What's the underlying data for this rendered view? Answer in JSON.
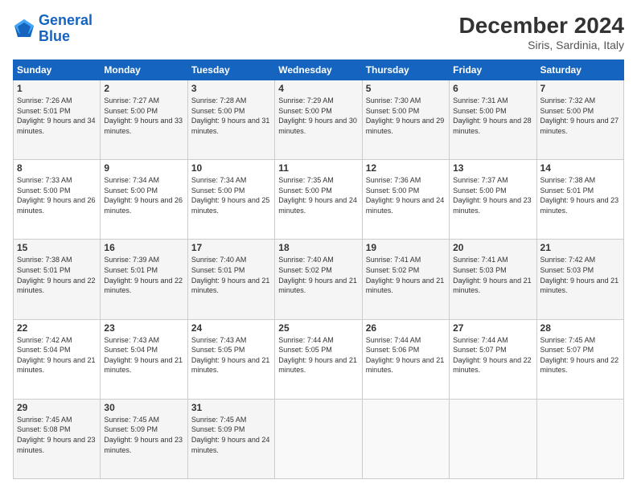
{
  "header": {
    "logo": {
      "line1": "General",
      "line2": "Blue"
    },
    "title": "December 2024",
    "subtitle": "Siris, Sardinia, Italy"
  },
  "weekdays": [
    "Sunday",
    "Monday",
    "Tuesday",
    "Wednesday",
    "Thursday",
    "Friday",
    "Saturday"
  ],
  "weeks": [
    [
      {
        "day": "1",
        "sunrise": "7:26 AM",
        "sunset": "5:01 PM",
        "daylight": "9 hours and 34 minutes."
      },
      {
        "day": "2",
        "sunrise": "7:27 AM",
        "sunset": "5:00 PM",
        "daylight": "9 hours and 33 minutes."
      },
      {
        "day": "3",
        "sunrise": "7:28 AM",
        "sunset": "5:00 PM",
        "daylight": "9 hours and 31 minutes."
      },
      {
        "day": "4",
        "sunrise": "7:29 AM",
        "sunset": "5:00 PM",
        "daylight": "9 hours and 30 minutes."
      },
      {
        "day": "5",
        "sunrise": "7:30 AM",
        "sunset": "5:00 PM",
        "daylight": "9 hours and 29 minutes."
      },
      {
        "day": "6",
        "sunrise": "7:31 AM",
        "sunset": "5:00 PM",
        "daylight": "9 hours and 28 minutes."
      },
      {
        "day": "7",
        "sunrise": "7:32 AM",
        "sunset": "5:00 PM",
        "daylight": "9 hours and 27 minutes."
      }
    ],
    [
      {
        "day": "8",
        "sunrise": "7:33 AM",
        "sunset": "5:00 PM",
        "daylight": "9 hours and 26 minutes."
      },
      {
        "day": "9",
        "sunrise": "7:34 AM",
        "sunset": "5:00 PM",
        "daylight": "9 hours and 26 minutes."
      },
      {
        "day": "10",
        "sunrise": "7:34 AM",
        "sunset": "5:00 PM",
        "daylight": "9 hours and 25 minutes."
      },
      {
        "day": "11",
        "sunrise": "7:35 AM",
        "sunset": "5:00 PM",
        "daylight": "9 hours and 24 minutes."
      },
      {
        "day": "12",
        "sunrise": "7:36 AM",
        "sunset": "5:00 PM",
        "daylight": "9 hours and 24 minutes."
      },
      {
        "day": "13",
        "sunrise": "7:37 AM",
        "sunset": "5:00 PM",
        "daylight": "9 hours and 23 minutes."
      },
      {
        "day": "14",
        "sunrise": "7:38 AM",
        "sunset": "5:01 PM",
        "daylight": "9 hours and 23 minutes."
      }
    ],
    [
      {
        "day": "15",
        "sunrise": "7:38 AM",
        "sunset": "5:01 PM",
        "daylight": "9 hours and 22 minutes."
      },
      {
        "day": "16",
        "sunrise": "7:39 AM",
        "sunset": "5:01 PM",
        "daylight": "9 hours and 22 minutes."
      },
      {
        "day": "17",
        "sunrise": "7:40 AM",
        "sunset": "5:01 PM",
        "daylight": "9 hours and 21 minutes."
      },
      {
        "day": "18",
        "sunrise": "7:40 AM",
        "sunset": "5:02 PM",
        "daylight": "9 hours and 21 minutes."
      },
      {
        "day": "19",
        "sunrise": "7:41 AM",
        "sunset": "5:02 PM",
        "daylight": "9 hours and 21 minutes."
      },
      {
        "day": "20",
        "sunrise": "7:41 AM",
        "sunset": "5:03 PM",
        "daylight": "9 hours and 21 minutes."
      },
      {
        "day": "21",
        "sunrise": "7:42 AM",
        "sunset": "5:03 PM",
        "daylight": "9 hours and 21 minutes."
      }
    ],
    [
      {
        "day": "22",
        "sunrise": "7:42 AM",
        "sunset": "5:04 PM",
        "daylight": "9 hours and 21 minutes."
      },
      {
        "day": "23",
        "sunrise": "7:43 AM",
        "sunset": "5:04 PM",
        "daylight": "9 hours and 21 minutes."
      },
      {
        "day": "24",
        "sunrise": "7:43 AM",
        "sunset": "5:05 PM",
        "daylight": "9 hours and 21 minutes."
      },
      {
        "day": "25",
        "sunrise": "7:44 AM",
        "sunset": "5:05 PM",
        "daylight": "9 hours and 21 minutes."
      },
      {
        "day": "26",
        "sunrise": "7:44 AM",
        "sunset": "5:06 PM",
        "daylight": "9 hours and 21 minutes."
      },
      {
        "day": "27",
        "sunrise": "7:44 AM",
        "sunset": "5:07 PM",
        "daylight": "9 hours and 22 minutes."
      },
      {
        "day": "28",
        "sunrise": "7:45 AM",
        "sunset": "5:07 PM",
        "daylight": "9 hours and 22 minutes."
      }
    ],
    [
      {
        "day": "29",
        "sunrise": "7:45 AM",
        "sunset": "5:08 PM",
        "daylight": "9 hours and 23 minutes."
      },
      {
        "day": "30",
        "sunrise": "7:45 AM",
        "sunset": "5:09 PM",
        "daylight": "9 hours and 23 minutes."
      },
      {
        "day": "31",
        "sunrise": "7:45 AM",
        "sunset": "5:09 PM",
        "daylight": "9 hours and 24 minutes."
      },
      null,
      null,
      null,
      null
    ]
  ]
}
